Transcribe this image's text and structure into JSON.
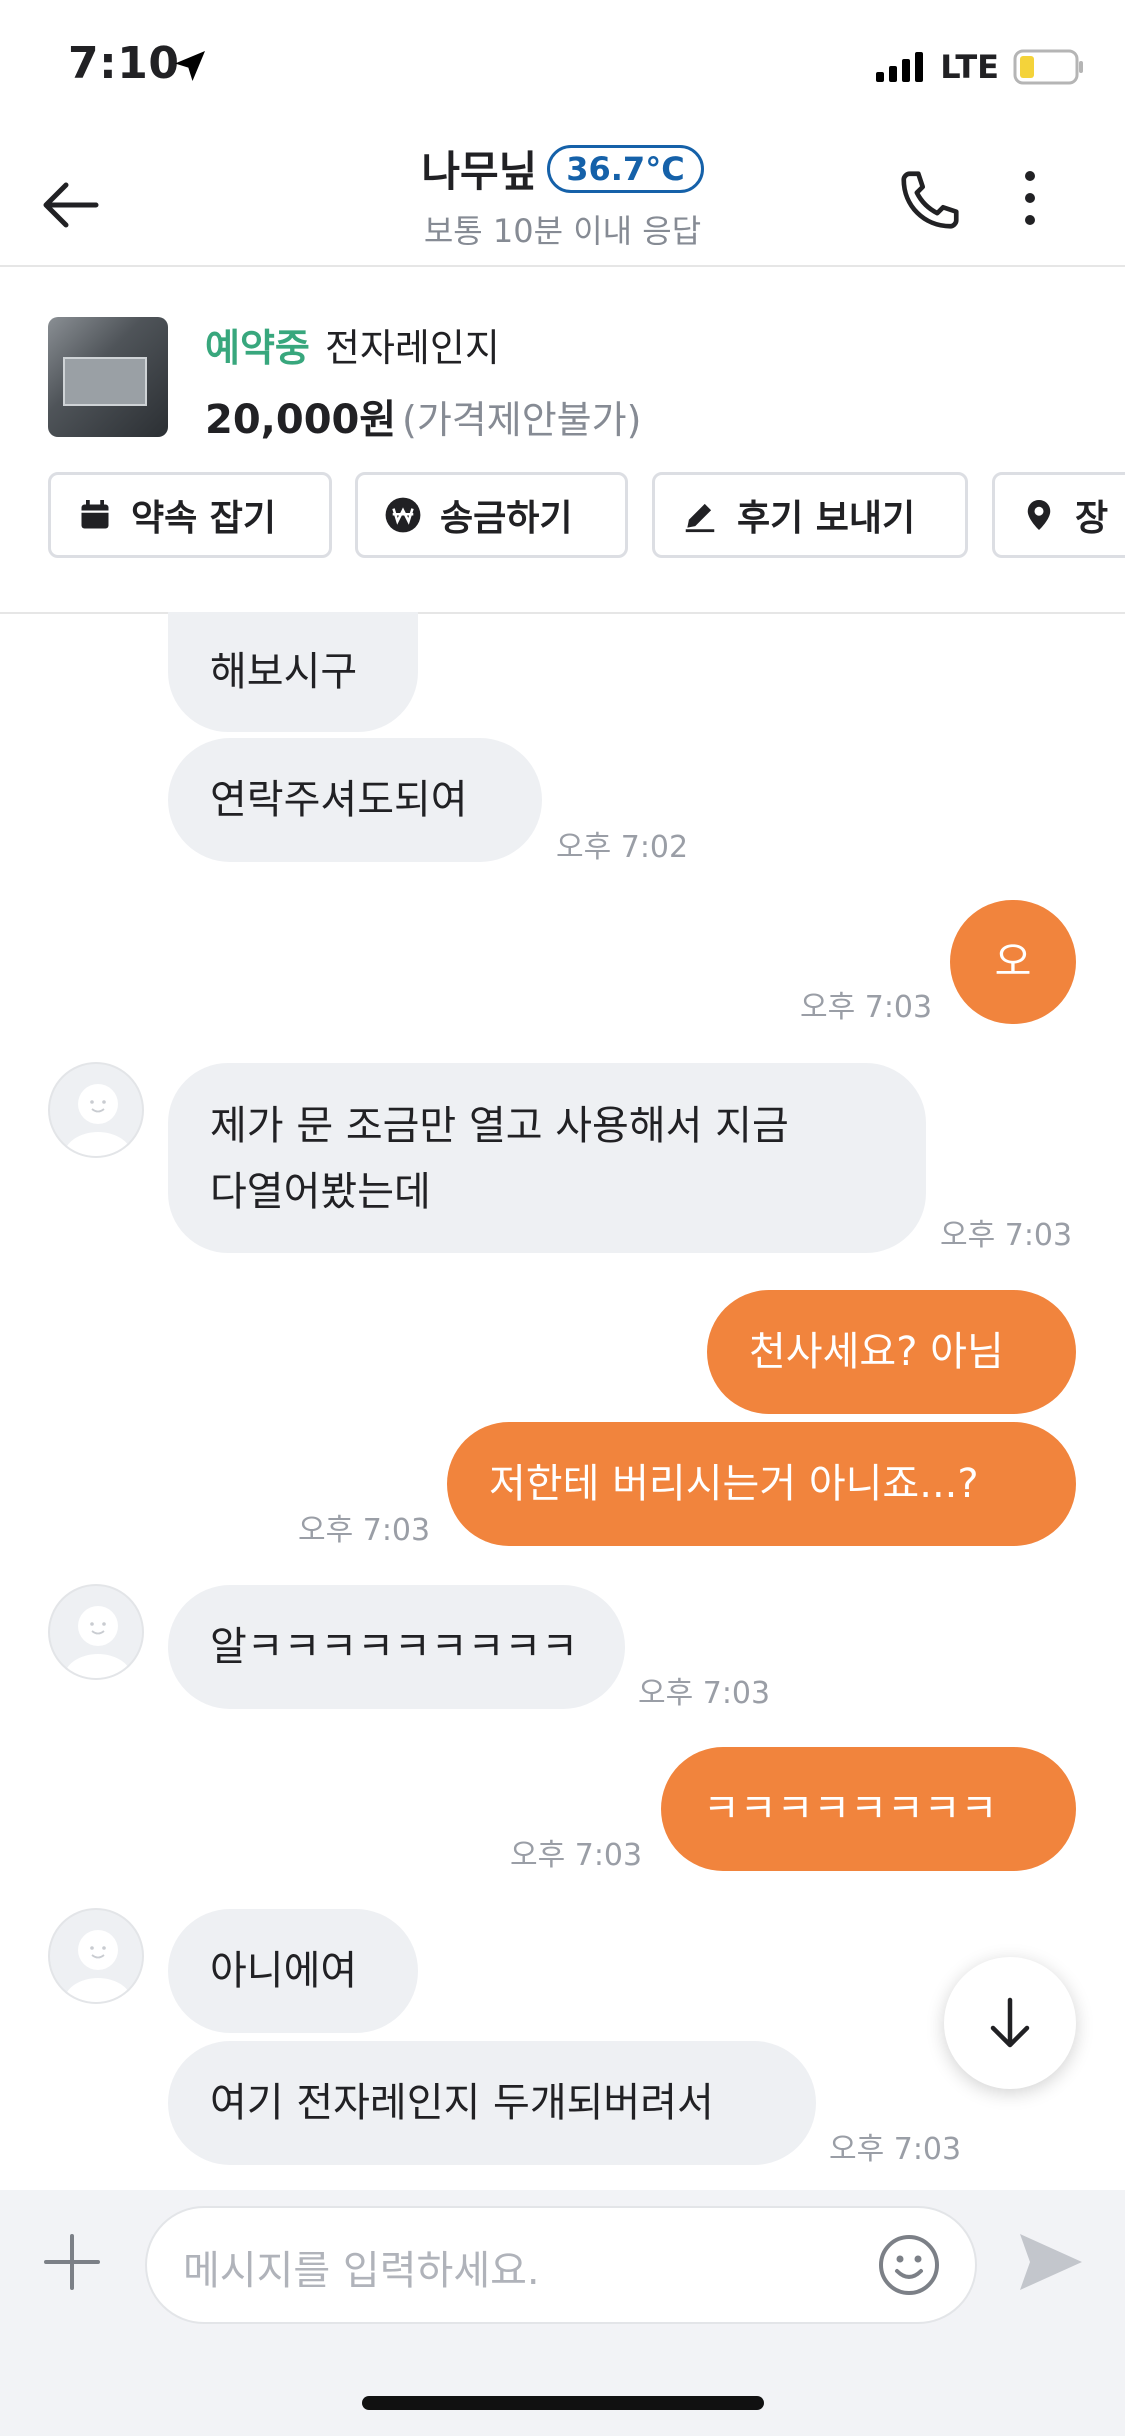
{
  "status_bar": {
    "time": "7:10",
    "network": "LTE"
  },
  "header": {
    "name": "나무닢",
    "temperature": "36.7°C",
    "response_time": "보통 10분 이내 응답"
  },
  "product": {
    "status": "예약중",
    "title": "전자레인지",
    "price": "20,000원",
    "price_note": "(가격제안불가)",
    "actions": [
      "약속 잡기",
      "송금하기",
      "후기 보내기",
      "장"
    ]
  },
  "messages": {
    "m1": "해보시구",
    "m2": "연락주셔도되여",
    "t2": "오후 7:02",
    "m3": "오",
    "t3": "오후 7:03",
    "m4_line1": "제가 문 조금만 열고 사용해서 지금",
    "m4_line2": "다열어봤는데",
    "t4": "오후 7:03",
    "m5": "천사세요? 아님",
    "m6": "저한테 버리시는거 아니죠...?",
    "t6": "오후 7:03",
    "m7": "알ㅋㅋㅋㅋㅋㅋㅋㅋㅋ",
    "t7": "오후 7:03",
    "m8": "ㅋㅋㅋㅋㅋㅋㅋㅋ",
    "t8": "오후 7:03",
    "m9": "아니에여",
    "m10": "여기 전자레인지 두개되버려서",
    "t10": "오후 7:03"
  },
  "composer": {
    "placeholder": "메시지를 입력하세요."
  },
  "colors": {
    "accent_orange": "#f1843d",
    "reserved_green": "#38a77d",
    "temp_blue": "#1561a9"
  }
}
